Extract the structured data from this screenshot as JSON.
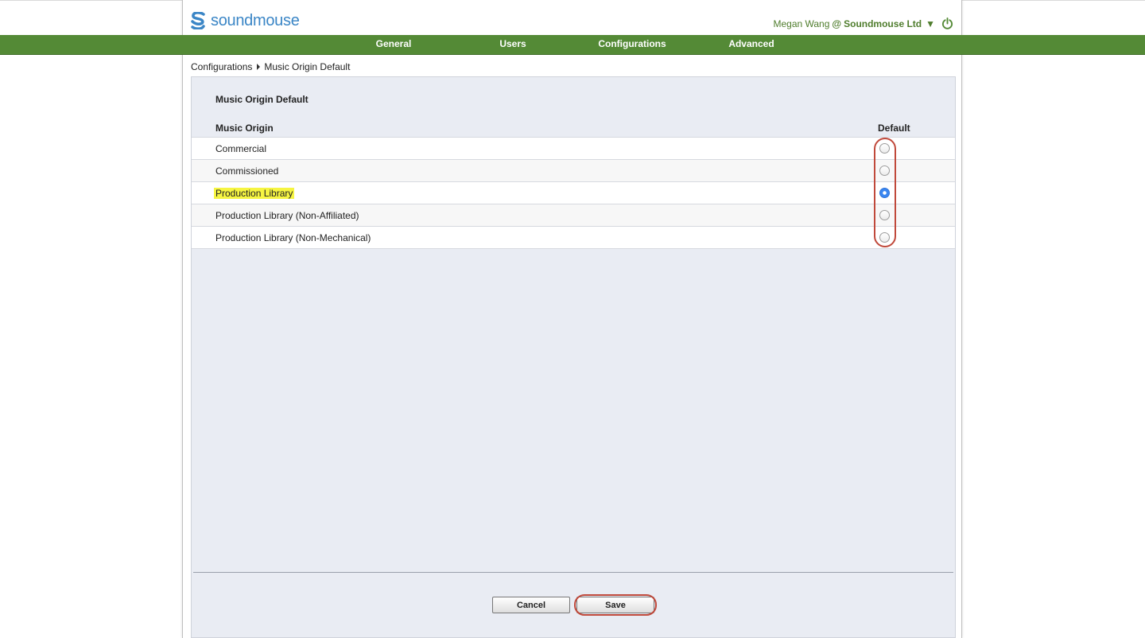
{
  "app": {
    "logo_text": "soundmouse",
    "brand_color": "#3b86c6",
    "accent_color": "#548a36"
  },
  "user": {
    "name": "Megan Wang",
    "at": "@",
    "company": "Soundmouse Ltd",
    "caret": "▼",
    "power_icon": "power-icon"
  },
  "nav": {
    "items": [
      {
        "label": "General"
      },
      {
        "label": "Users"
      },
      {
        "label": "Configurations"
      },
      {
        "label": "Advanced"
      }
    ]
  },
  "breadcrumb": {
    "parent": "Configurations",
    "current": "Music Origin Default"
  },
  "panel": {
    "title": "Music Origin Default",
    "column_origin": "Music Origin",
    "column_default": "Default",
    "rows": [
      {
        "label": "Commercial",
        "selected": false,
        "highlighted": false
      },
      {
        "label": "Commissioned",
        "selected": false,
        "highlighted": false
      },
      {
        "label": "Production Library",
        "selected": true,
        "highlighted": true
      },
      {
        "label": "Production Library (Non-Affiliated)",
        "selected": false,
        "highlighted": false
      },
      {
        "label": "Production Library (Non-Mechanical)",
        "selected": false,
        "highlighted": false
      }
    ]
  },
  "actions": {
    "cancel_label": "Cancel",
    "save_label": "Save"
  }
}
